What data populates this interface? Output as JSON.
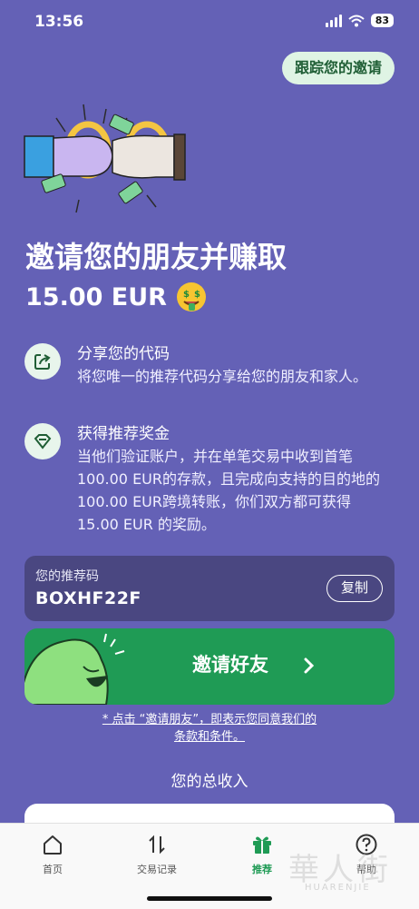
{
  "status_bar": {
    "time": "13:56",
    "battery": "83"
  },
  "header": {
    "track_invites_label": "跟踪您的邀请"
  },
  "hero": {
    "title": "邀请您的朋友并赚取",
    "amount": "15.00 EUR"
  },
  "steps": [
    {
      "icon": "share-icon",
      "title": "分享您的代码",
      "body": "将您唯一的推荐代码分享给您的朋友和家人。"
    },
    {
      "icon": "diamond-icon",
      "title": "获得推荐奖金",
      "body": "当他们验证账户，并在单笔交易中收到首笔100.00 EUR的存款，且完成向支持的目的地的100.00 EUR跨境转账，你们双方都可获得15.00 EUR 的奖励。"
    }
  ],
  "referral": {
    "label": "您的推荐码",
    "code": "BOXHF22F",
    "copy_label": "复制"
  },
  "invite": {
    "label": "邀请好友"
  },
  "terms": {
    "line1": "* 点击 “邀请朋友”，即表示您同意我们的",
    "line2": "条款和条件。"
  },
  "earnings": {
    "title": "您的总收入"
  },
  "tabs": [
    {
      "icon": "home-icon",
      "label": "首页",
      "active": false
    },
    {
      "icon": "transactions-icon",
      "label": "交易记录",
      "active": false
    },
    {
      "icon": "gift-icon",
      "label": "推荐",
      "active": true
    },
    {
      "icon": "help-icon",
      "label": "帮助",
      "active": false
    }
  ],
  "colors": {
    "background": "#6461b6",
    "accent_green": "#1f9b55",
    "card": "#4a4781"
  },
  "watermark": {
    "text": "華人街",
    "subtext": "HUARENJIE"
  }
}
